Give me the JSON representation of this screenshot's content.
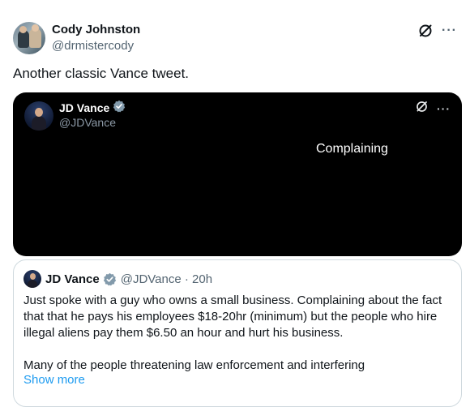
{
  "author": {
    "display_name": "Cody Johnston",
    "handle": "@drmistercody"
  },
  "tweet_text": "Another classic Vance tweet.",
  "icons": {
    "grok": "grok-icon",
    "more": "more-icon",
    "verified": "verified-badge-icon"
  },
  "more_glyph": "···",
  "video_card": {
    "display_name": "JD Vance",
    "handle": "@JDVance",
    "caption": "Complaining"
  },
  "quoted_tweet": {
    "display_name": "JD Vance",
    "handle_time": "@JDVance · 20h",
    "paragraph1": "Just spoke with a guy who owns a small business. Complaining about the fact that that he pays his employees $18-20hr (minimum) but the people who hire illegal aliens pay them $6.50 an hour and hurt his business.",
    "paragraph2": "Many of the people threatening law enforcement and interfering",
    "show_more": "Show more"
  },
  "colors": {
    "text": "#0f1419",
    "secondary": "#536471",
    "link": "#1d9bf0",
    "verified_badge": "#829aab",
    "video_bg": "#000000"
  }
}
